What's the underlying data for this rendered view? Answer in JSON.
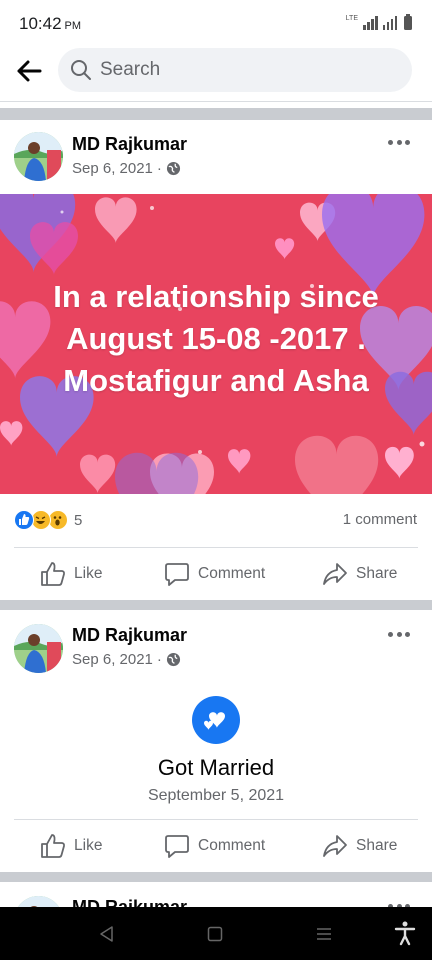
{
  "status_bar": {
    "time": "10:42",
    "ampm": "PM",
    "network": "LTE"
  },
  "search": {
    "placeholder": "Search"
  },
  "posts": [
    {
      "author": "MD Rajkumar",
      "date": "Sep 6, 2021",
      "separator": "·",
      "banner_lines": [
        "In a relationship since",
        "August 15-08 -2017 .",
        "Mostafigur and  Asha"
      ],
      "reaction_count": "5",
      "comment_count": "1 comment"
    },
    {
      "author": "MD Rajkumar",
      "date": "Sep 6, 2021",
      "separator": "·",
      "life_event_title": "Got Married",
      "life_event_date": "September 5, 2021"
    },
    {
      "author": "MD Rajkumar"
    }
  ],
  "actions": {
    "like": "Like",
    "comment": "Comment",
    "share": "Share"
  },
  "colors": {
    "brand_blue": "#1877f2",
    "banner_red": "#e8445f",
    "separator_gray": "#c9ccd1"
  },
  "icons": [
    "back-arrow-icon",
    "search-icon",
    "globe-icon",
    "more-icon",
    "like-icon",
    "comment-icon",
    "share-icon",
    "love-icon"
  ]
}
